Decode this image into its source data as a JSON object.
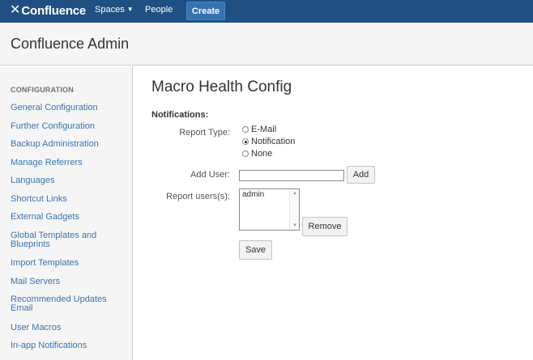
{
  "topbar": {
    "logo_text": "Confluence",
    "logo_mark": "✕",
    "nav": {
      "spaces_label": "Spaces",
      "people_label": "People",
      "create_label": "Create"
    }
  },
  "header": {
    "title": "Confluence Admin"
  },
  "sidebar": {
    "heading": "CONFIGURATION",
    "items": [
      {
        "label": "General Configuration"
      },
      {
        "label": "Further Configuration"
      },
      {
        "label": "Backup Administration"
      },
      {
        "label": "Manage Referrers"
      },
      {
        "label": "Languages"
      },
      {
        "label": "Shortcut Links"
      },
      {
        "label": "External Gadgets"
      },
      {
        "label": "Global Templates and Blueprints"
      },
      {
        "label": "Import Templates"
      },
      {
        "label": "Mail Servers"
      },
      {
        "label": "Recommended Updates Email"
      },
      {
        "label": "User Macros"
      },
      {
        "label": "In-app Notifications"
      }
    ]
  },
  "main": {
    "title": "Macro Health Config",
    "notifications_label": "Notifications:",
    "report_type": {
      "label": "Report Type:",
      "options": [
        {
          "label": "E-Mail",
          "checked": false
        },
        {
          "label": "Notification",
          "checked": true
        },
        {
          "label": "None",
          "checked": false
        }
      ]
    },
    "add_user": {
      "label": "Add User:",
      "value": "",
      "button_label": "Add"
    },
    "report_users": {
      "label": "Report users(s):",
      "items": [
        "admin"
      ],
      "remove_label": "Remove"
    },
    "save_label": "Save"
  },
  "colors": {
    "topbar": "#205081",
    "create_button": "#3572b0",
    "link": "#3b73af",
    "sidebar_bg": "#f5f5f5"
  }
}
